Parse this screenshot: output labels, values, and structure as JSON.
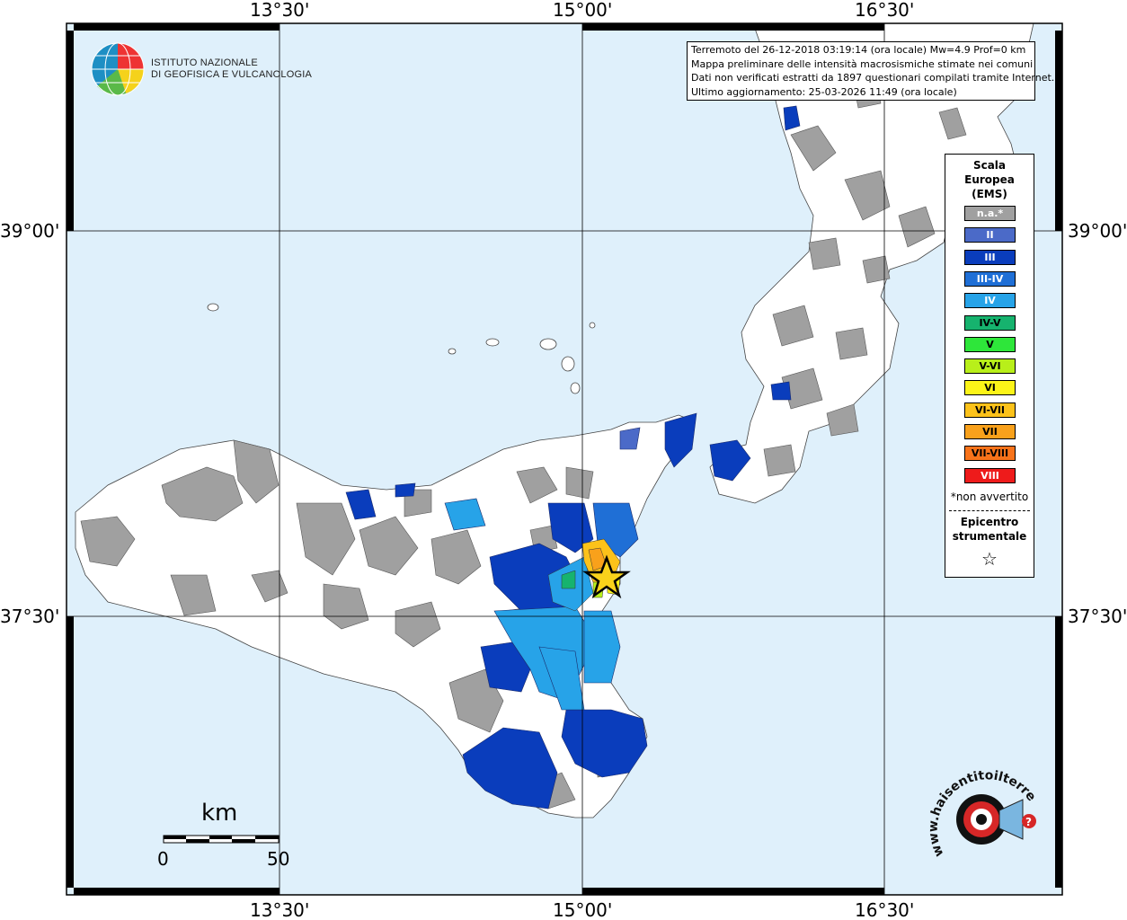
{
  "map": {
    "top_lon_labels": [
      "13°30'",
      "15°00'",
      "16°30'"
    ],
    "bottom_lon_labels": [
      "13°30'",
      "15°00'",
      "16°30'"
    ],
    "left_lat_labels": [
      "39°00'",
      "37°30'"
    ],
    "right_lat_labels": [
      "39°00'",
      "37°30'"
    ],
    "sea_color": "#dff0fb",
    "land_color": "#ffffff"
  },
  "logo": {
    "line1": "ISTITUTO NAZIONALE",
    "line2": "DI GEOFISICA E VULCANOLOGIA"
  },
  "info": {
    "line1": "Terremoto del 26-12-2018 03:19:14 (ora locale) Mw=4.9 Prof=0 km",
    "line2": "Mappa preliminare delle intensità macrosismiche stimate nei comuni",
    "line3": "Dati non verificati estratti da 1897 questionari compilati tramite Internet.",
    "line4": "Ultimo aggiornamento: 25-03-2026 11:49 (ora locale)"
  },
  "legend": {
    "title1": "Scala",
    "title2": "Europea",
    "title3": "(EMS)",
    "items": [
      {
        "label": "n.a.*",
        "color": "#a0a0a0"
      },
      {
        "label": "II",
        "color": "#4b6ac8"
      },
      {
        "label": "III",
        "color": "#0a3dbc"
      },
      {
        "label": "III-IV",
        "color": "#1f6fd6"
      },
      {
        "label": "IV",
        "color": "#27a3e8"
      },
      {
        "label": "IV-V",
        "color": "#16b36e"
      },
      {
        "label": "V",
        "color": "#2ee63a"
      },
      {
        "label": "V-VI",
        "color": "#b8ef1a"
      },
      {
        "label": "VI",
        "color": "#fcf418"
      },
      {
        "label": "VI-VII",
        "color": "#fcc21a"
      },
      {
        "label": "VII",
        "color": "#f9a11b"
      },
      {
        "label": "VII-VIII",
        "color": "#f8731a"
      },
      {
        "label": "VIII",
        "color": "#ee1b1b"
      }
    ],
    "note": "*non avvertito",
    "epi1": "Epicentro",
    "epi2": "strumentale",
    "star": "☆"
  },
  "scale": {
    "unit": "km",
    "start": "0",
    "end": "50"
  },
  "hsit": {
    "text": "www.haisentitoilterremoto.it"
  }
}
